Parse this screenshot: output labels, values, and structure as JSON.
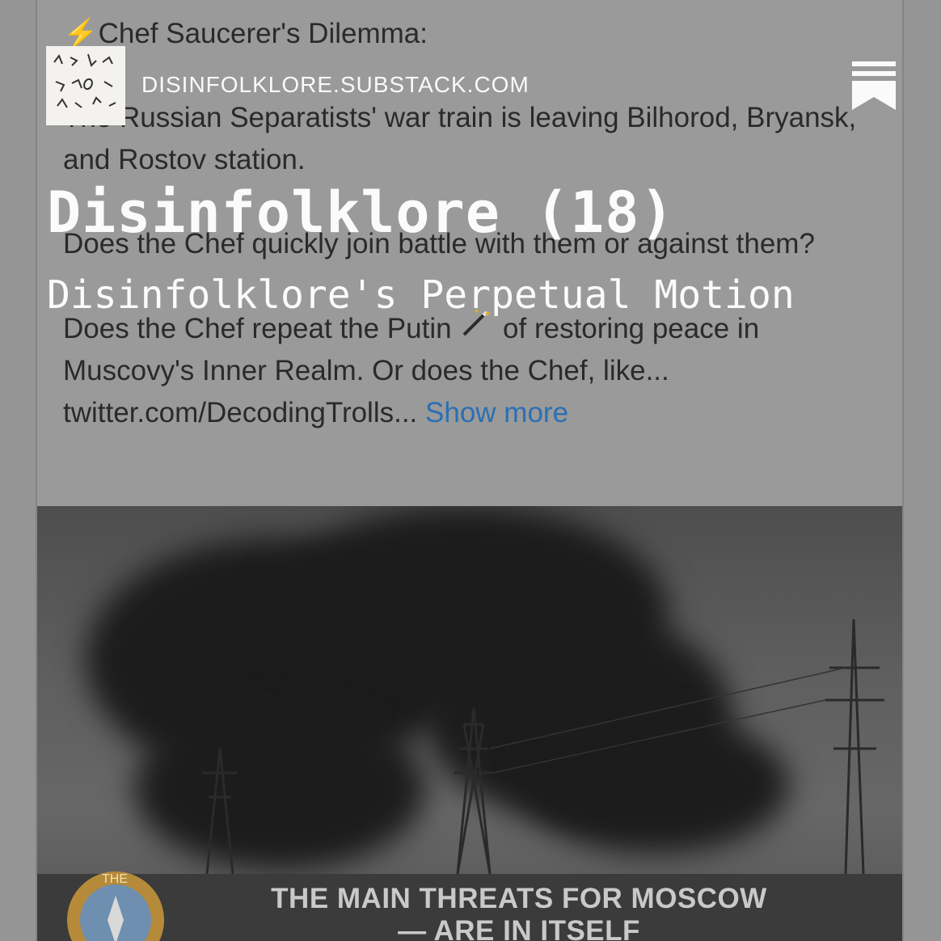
{
  "tweet": {
    "line1_icon": "⚡",
    "line1_text": "Chef Saucerer's Dilemma:",
    "para1": "The Russian Separatists' war train is leaving Bilhorod, Bryansk, and Rostov station.",
    "para2": "Does the Chef quickly join battle with them or against them?",
    "para3_before": "Does the Chef repeat the Putin ",
    "para3_icon": "magic-wand-icon",
    "para3_after": " of restoring peace in Muscovy's Inner Realm. Or does the Chef, like...",
    "link": "twitter.com/DecodingTrolls...",
    "show_more": "Show more"
  },
  "image": {
    "caption_line1": "THE MAIN THREATS FOR MOSCOW",
    "caption_line2": "— ARE IN ITSELF",
    "emblem_text": "THE"
  },
  "overlay": {
    "domain": "DISINFOLKLORE.SUBSTACK.COM",
    "title": "Disinfolklore (18)",
    "subtitle": "Disinfolklore's Perpetual Motion"
  },
  "colors": {
    "background": "#959595",
    "link": "#2a6fb4",
    "overlay_text": "#fbfbfb"
  }
}
